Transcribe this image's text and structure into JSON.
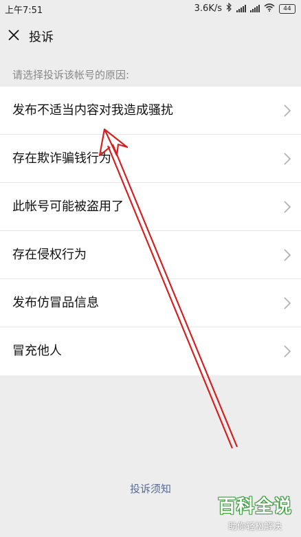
{
  "status_bar": {
    "time": "上午7:51",
    "network_speed": "3.6K/s",
    "battery_level": "44",
    "icons": [
      "bluetooth-icon",
      "signal-icon",
      "signal-icon",
      "wifi-icon",
      "battery-icon"
    ]
  },
  "header": {
    "title": "投诉",
    "close_icon": "close-icon"
  },
  "section_label": "请选择投诉该帐号的原因:",
  "reasons": [
    {
      "label": "发布不适当内容对我造成骚扰"
    },
    {
      "label": "存在欺诈骗钱行为"
    },
    {
      "label": "此帐号可能被盗用了"
    },
    {
      "label": "存在侵权行为"
    },
    {
      "label": "发布仿冒品信息"
    },
    {
      "label": "冒充他人"
    }
  ],
  "footer_link": "投诉须知",
  "annotation": {
    "type": "arrow",
    "color": "#d42020"
  },
  "watermark": {
    "main": "百科全说",
    "sub": "助你轻松解决"
  },
  "colors": {
    "background": "#ededed",
    "list_bg": "#ffffff",
    "link": "#576b95",
    "watermark_green": "#3a9a3a"
  }
}
